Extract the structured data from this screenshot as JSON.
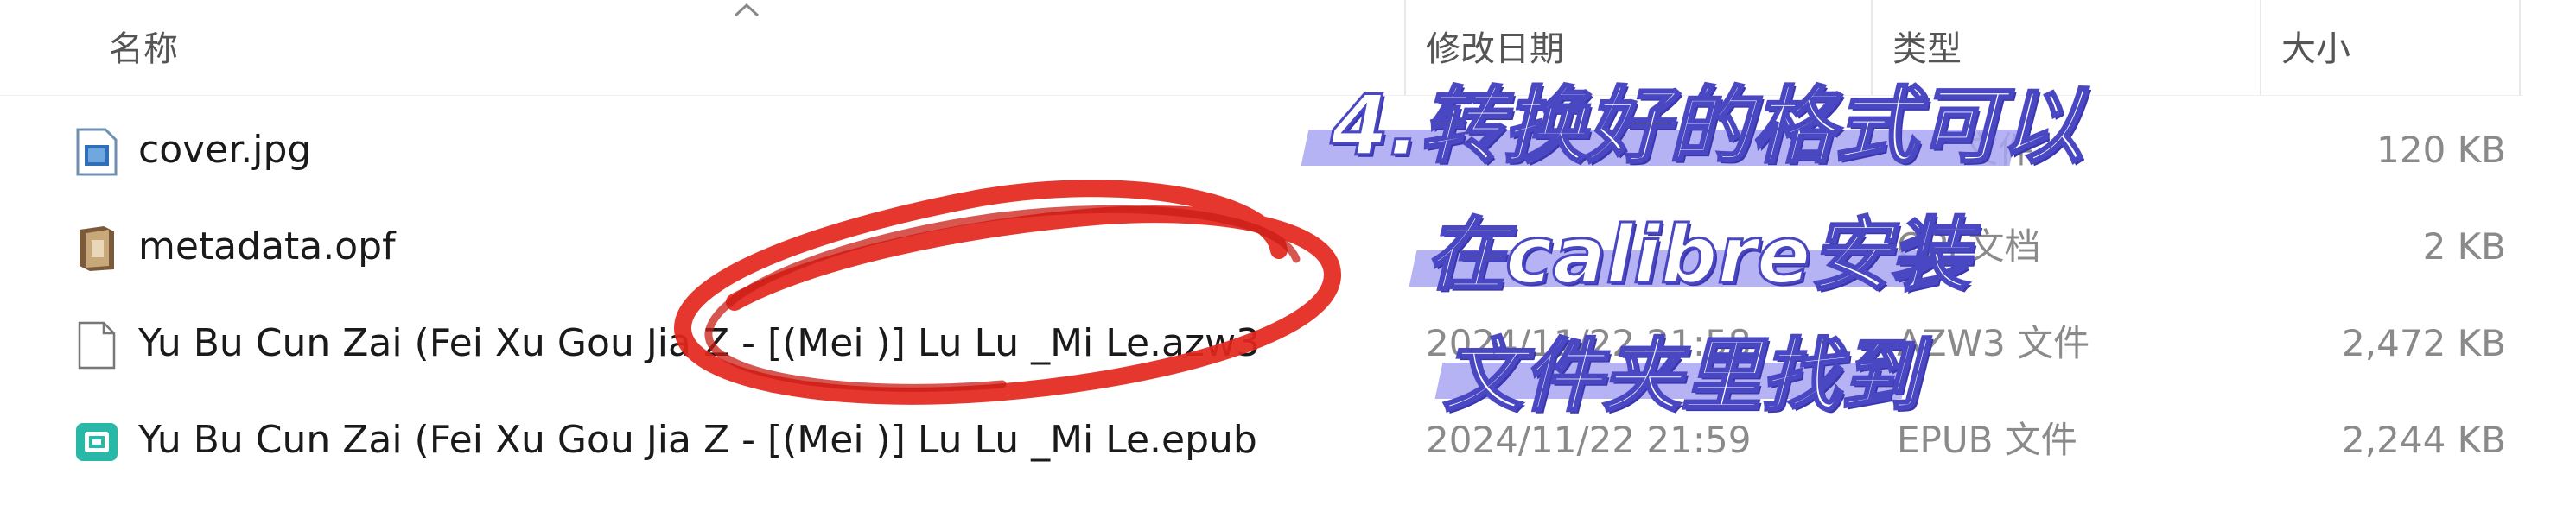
{
  "columns": {
    "name": "名称",
    "modified": "修改日期",
    "type": "类型",
    "size": "大小"
  },
  "files": [
    {
      "icon": "image-file-icon",
      "name": "cover.jpg",
      "modified": "",
      "type": "文件",
      "size": "120 KB"
    },
    {
      "icon": "opf-file-icon",
      "name": "metadata.opf",
      "modified": "",
      "type": "OPF文档",
      "size": "2 KB"
    },
    {
      "icon": "blank-file-icon",
      "name": "Yu Bu Cun Zai (Fei Xu Gou Jia Z - [(Mei )] Lu Lu _Mi Le.azw3",
      "modified": "2024/11/22 21:58",
      "type": "AZW3 文件",
      "size": "2,472 KB"
    },
    {
      "icon": "epub-file-icon",
      "name": "Yu Bu Cun Zai (Fei Xu Gou Jia Z - [(Mei )] Lu Lu _Mi Le.epub",
      "modified": "2024/11/22 21:59",
      "type": "EPUB 文件",
      "size": "2,244 KB"
    }
  ],
  "annotation": {
    "line1": "4.转换好的格式可以",
    "line2": "在calibre安装",
    "line3": "文件夹里找到",
    "circle_color": "#e3261c",
    "caption_color": "#4a47c2",
    "highlight_color": "#a9a6f2"
  }
}
